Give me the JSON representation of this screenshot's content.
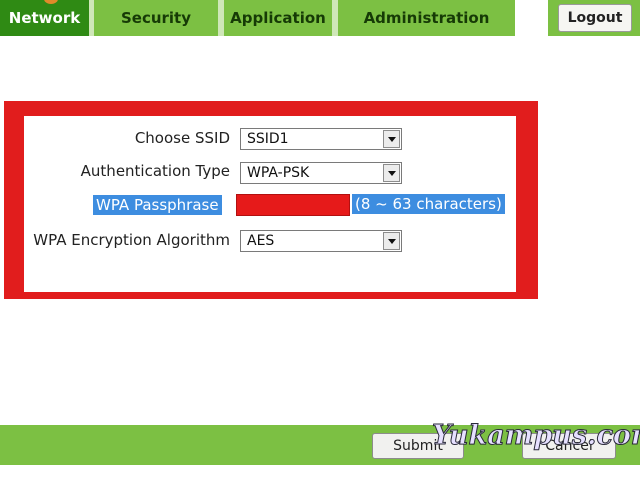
{
  "nav": {
    "tabs": [
      {
        "label": "Network",
        "active": true
      },
      {
        "label": "Security",
        "active": false
      },
      {
        "label": "Application",
        "active": false
      },
      {
        "label": "Administration",
        "active": false
      }
    ],
    "logout_label": "Logout"
  },
  "form": {
    "ssid": {
      "label": "Choose SSID",
      "value": "SSID1"
    },
    "auth": {
      "label": "Authentication Type",
      "value": "WPA-PSK"
    },
    "passphrase": {
      "label": "WPA Passphrase",
      "hint": "(8 ~ 63 characters)"
    },
    "encryption": {
      "label": "WPA Encryption Algorithm",
      "value": "AES"
    }
  },
  "footer": {
    "submit_label": "Submit",
    "cancel_label": "Cancel"
  },
  "watermark": "Yukampus.com",
  "colors": {
    "nav_green": "#7cc043",
    "nav_active": "#2f8a14",
    "highlight_frame": "#e11d1d",
    "selection_blue": "#3d8de0"
  }
}
